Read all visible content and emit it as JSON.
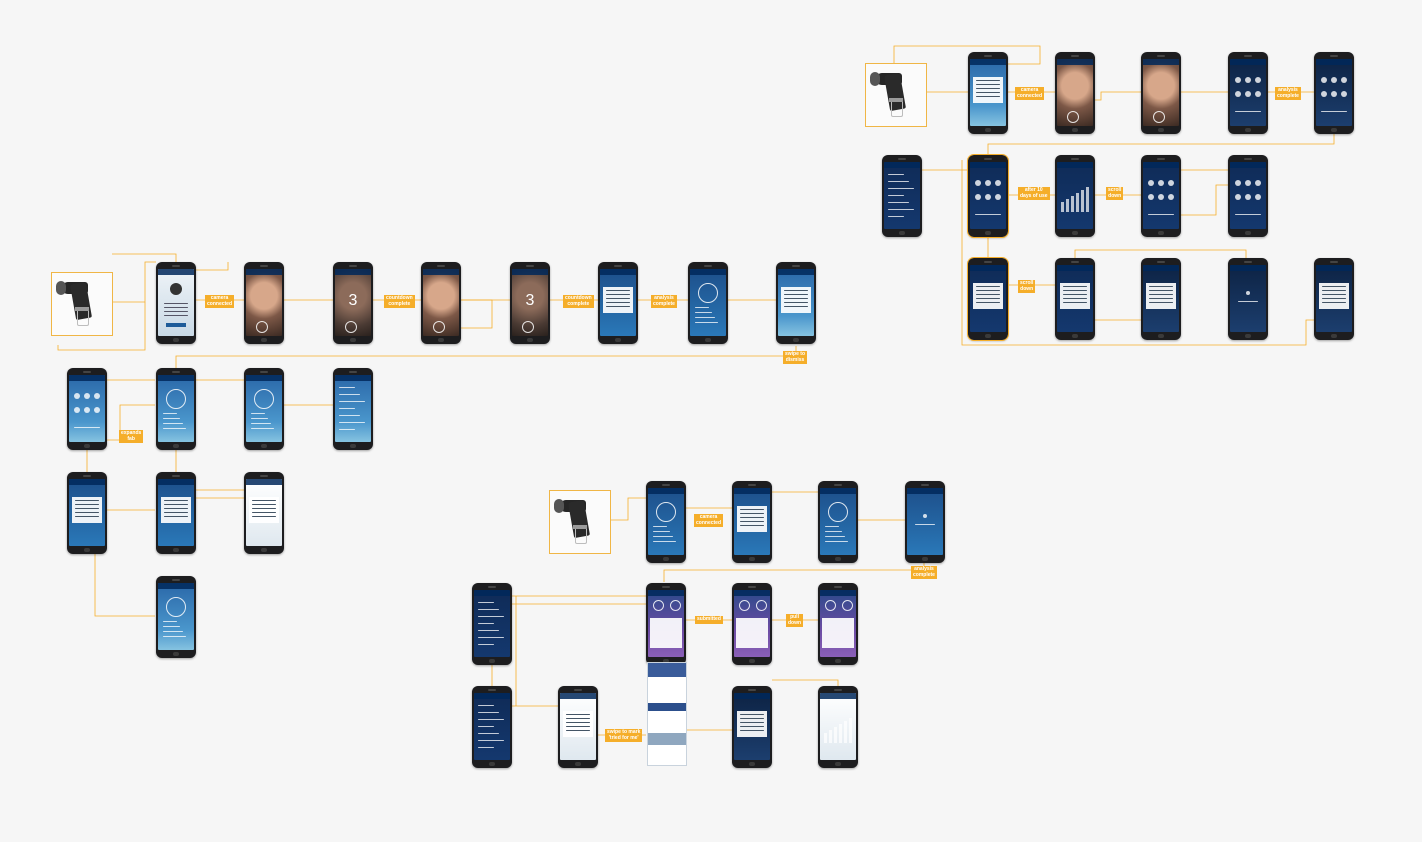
{
  "colors": {
    "accent": "#f5ae2a",
    "canvas": "#f6f6f6",
    "phone_body": "#1d1d1f"
  },
  "screen_overlays": {
    "countdown_digit": "3"
  },
  "transitions": {
    "camera_connected": "camera\nconnected",
    "countdown_complete": "countdown\ncomplete",
    "analysis_complete": "analysis\ncomplete",
    "swipe_to_dismiss": "swipe to\ndismiss",
    "expands_fab": "expands\nfab",
    "after_10_days": "after 10\ndays of use",
    "scroll_down": "scroll\ndown",
    "submitted": "submitted",
    "pull_down": "pull\ndown",
    "swipe_to_mark": "swipe to mark\n'tried for me'"
  }
}
